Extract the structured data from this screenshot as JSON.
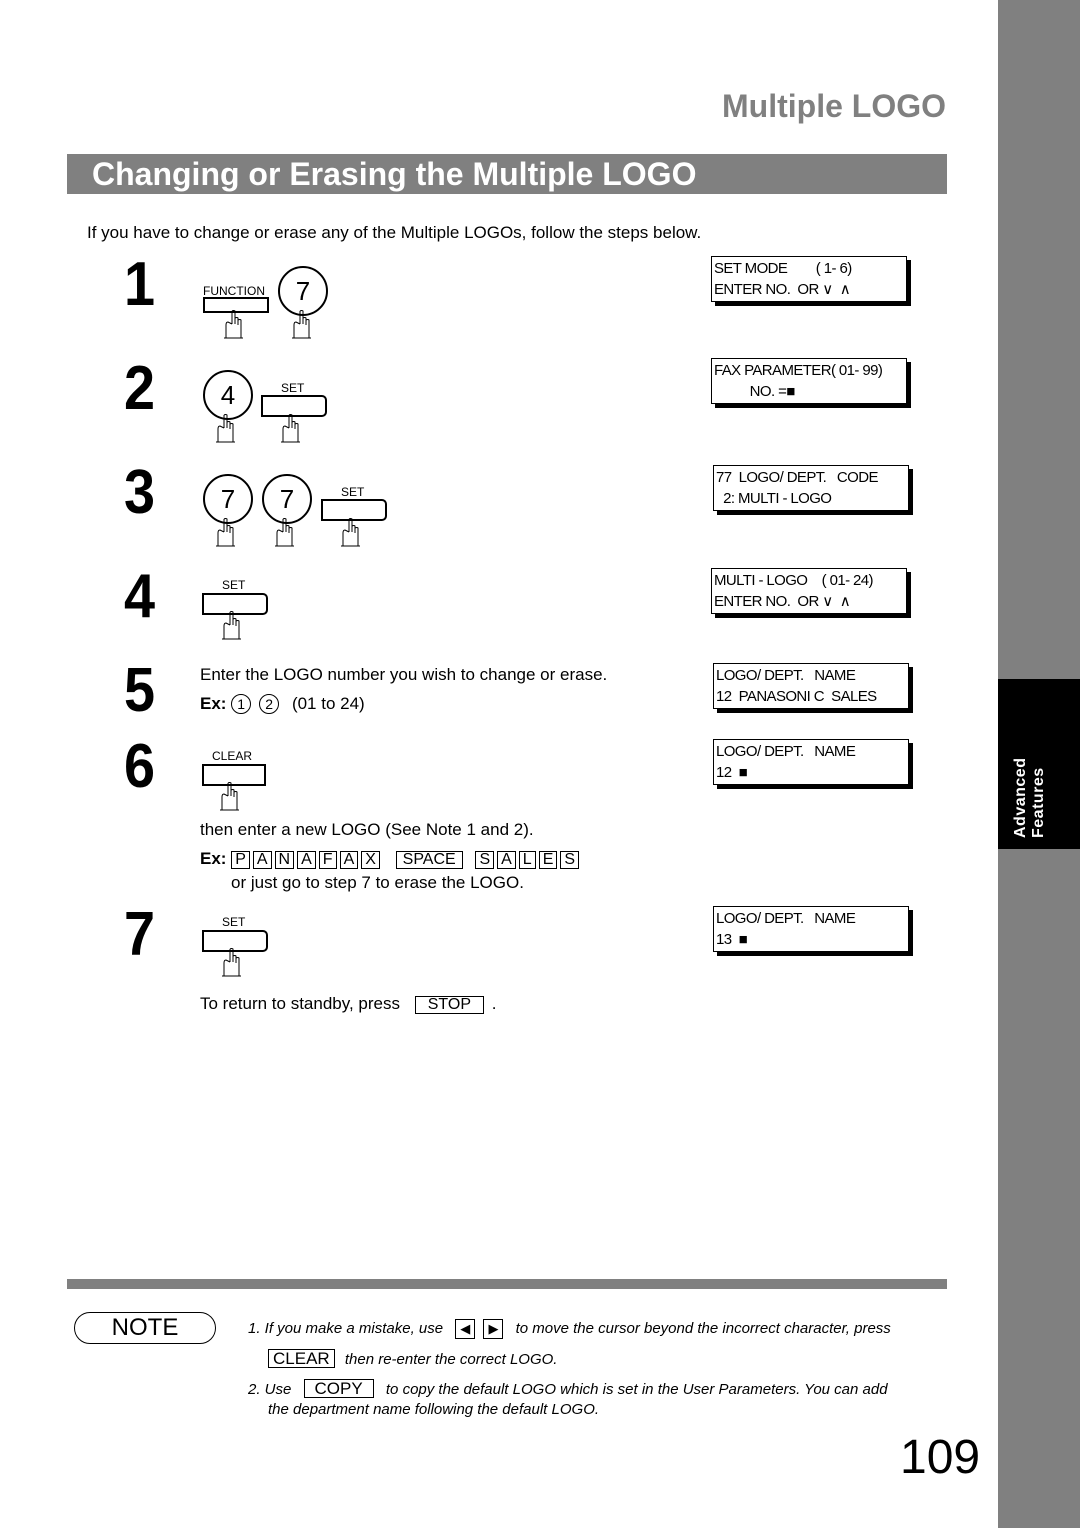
{
  "header": {
    "section_title": "Multiple LOGO",
    "banner_title": "Changing or Erasing the Multiple LOGO"
  },
  "intro": "If you have to change or erase any of the Multiple LOGOs, follow the steps below.",
  "side_tab": {
    "line1": "Advanced",
    "line2": "Features",
    "colors": {
      "tab": "#808080",
      "active": "#000000"
    }
  },
  "steps": [
    {
      "number": "1",
      "keys": [
        {
          "type": "rect",
          "label": "FUNCTION"
        },
        {
          "type": "circle",
          "label": "7"
        }
      ],
      "lcd": [
        "SET MODE        ( 1- 6)",
        "ENTER NO.  OR ∨  ∧"
      ]
    },
    {
      "number": "2",
      "keys": [
        {
          "type": "circle",
          "label": "4"
        },
        {
          "type": "rect",
          "label": "SET"
        }
      ],
      "lcd": [
        "FAX PARAMETER( 01- 99)",
        "          NO. =■"
      ]
    },
    {
      "number": "3",
      "keys": [
        {
          "type": "circle",
          "label": "7"
        },
        {
          "type": "circle",
          "label": "7"
        },
        {
          "type": "rect",
          "label": "SET"
        }
      ],
      "lcd": [
        "77  LOGO/ DEPT.   CODE",
        "  2: MULTI - LOGO"
      ]
    },
    {
      "number": "4",
      "keys": [
        {
          "type": "rect",
          "label": "SET"
        }
      ],
      "lcd": [
        "MULTI - LOGO    ( 01- 24)",
        "ENTER NO.  OR ∨  ∧"
      ]
    },
    {
      "number": "5",
      "text": "Enter the LOGO number you wish to change or erase.",
      "example_label": "Ex:",
      "example_keys": [
        "1",
        "2"
      ],
      "example_range": "(01 to 24)",
      "lcd": [
        "LOGO/ DEPT.   NAME",
        "12  PANASONI C  SALES"
      ]
    },
    {
      "number": "6",
      "keys": [
        {
          "type": "rect",
          "label": "CLEAR"
        }
      ],
      "lcd": [
        "LOGO/ DEPT.   NAME",
        "12  ■"
      ],
      "after_text": "then enter a new LOGO (See Note 1 and 2).",
      "example_label": "Ex:",
      "example_chars": [
        "P",
        "A",
        "N",
        "A",
        "F",
        "A",
        "X"
      ],
      "example_space": "SPACE",
      "example_chars2": [
        "S",
        "A",
        "L",
        "E",
        "S"
      ],
      "alt_text": "or just go to step 7 to erase the LOGO."
    },
    {
      "number": "7",
      "keys": [
        {
          "type": "rect",
          "label": "SET"
        }
      ],
      "lcd": [
        "LOGO/ DEPT.   NAME",
        "13  ■"
      ]
    }
  ],
  "standby": {
    "text": "To return to standby, press",
    "key": "STOP",
    "end": "."
  },
  "note": {
    "badge": "NOTE",
    "item1_prefix": "1.  If you make a mistake, use",
    "item1_left_icon": "left-arrow-icon",
    "item1_right_icon": "right-arrow-icon",
    "item1_mid": "to move the cursor beyond the incorrect character, press",
    "item1_key": "CLEAR",
    "item1_suffix": "then re-enter the correct LOGO.",
    "item2_prefix": "2.  Use",
    "item2_key": "COPY",
    "item2_mid": "to copy the default LOGO which is set in the User Parameters.  You can add",
    "item2_suffix": "the department name following the default LOGO."
  },
  "page_number": "109"
}
